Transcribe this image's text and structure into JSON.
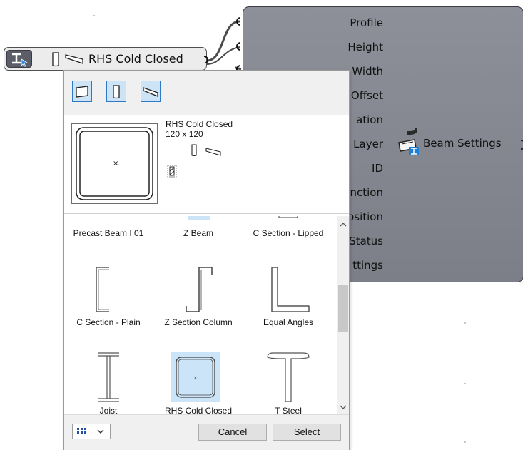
{
  "component": {
    "inputs": [
      "Profile",
      "Height",
      "Width",
      "Offset",
      "ation",
      "Layer",
      "ID",
      "nction",
      "osition",
      "Status",
      "ttings"
    ],
    "output": "Beam Settings"
  },
  "value_list": {
    "title": "RHS Cold Closed"
  },
  "popup": {
    "preview": {
      "name": "RHS Cold Closed",
      "size": "120 x 120"
    },
    "items": [
      {
        "label": "Precast Beam I 01",
        "icon": "precast-beam-icon"
      },
      {
        "label": "Z Beam",
        "icon": "z-beam-icon"
      },
      {
        "label": "C Section - Lipped",
        "icon": "c-section-lipped-icon"
      },
      {
        "label": "C Section - Plain",
        "icon": "c-section-plain-icon"
      },
      {
        "label": "Z Section Column",
        "icon": "z-section-column-icon"
      },
      {
        "label": "Equal Angles",
        "icon": "equal-angles-icon"
      },
      {
        "label": "Joist",
        "icon": "joist-icon"
      },
      {
        "label": "RHS Cold Closed",
        "icon": "rhs-cold-closed-icon",
        "selected": true
      },
      {
        "label": "T Steel",
        "icon": "t-steel-icon"
      }
    ],
    "cancel": "Cancel",
    "select": "Select"
  },
  "colors": {
    "selection": "#cce4f7",
    "accent": "#2e7ac9",
    "component": "#858791"
  }
}
